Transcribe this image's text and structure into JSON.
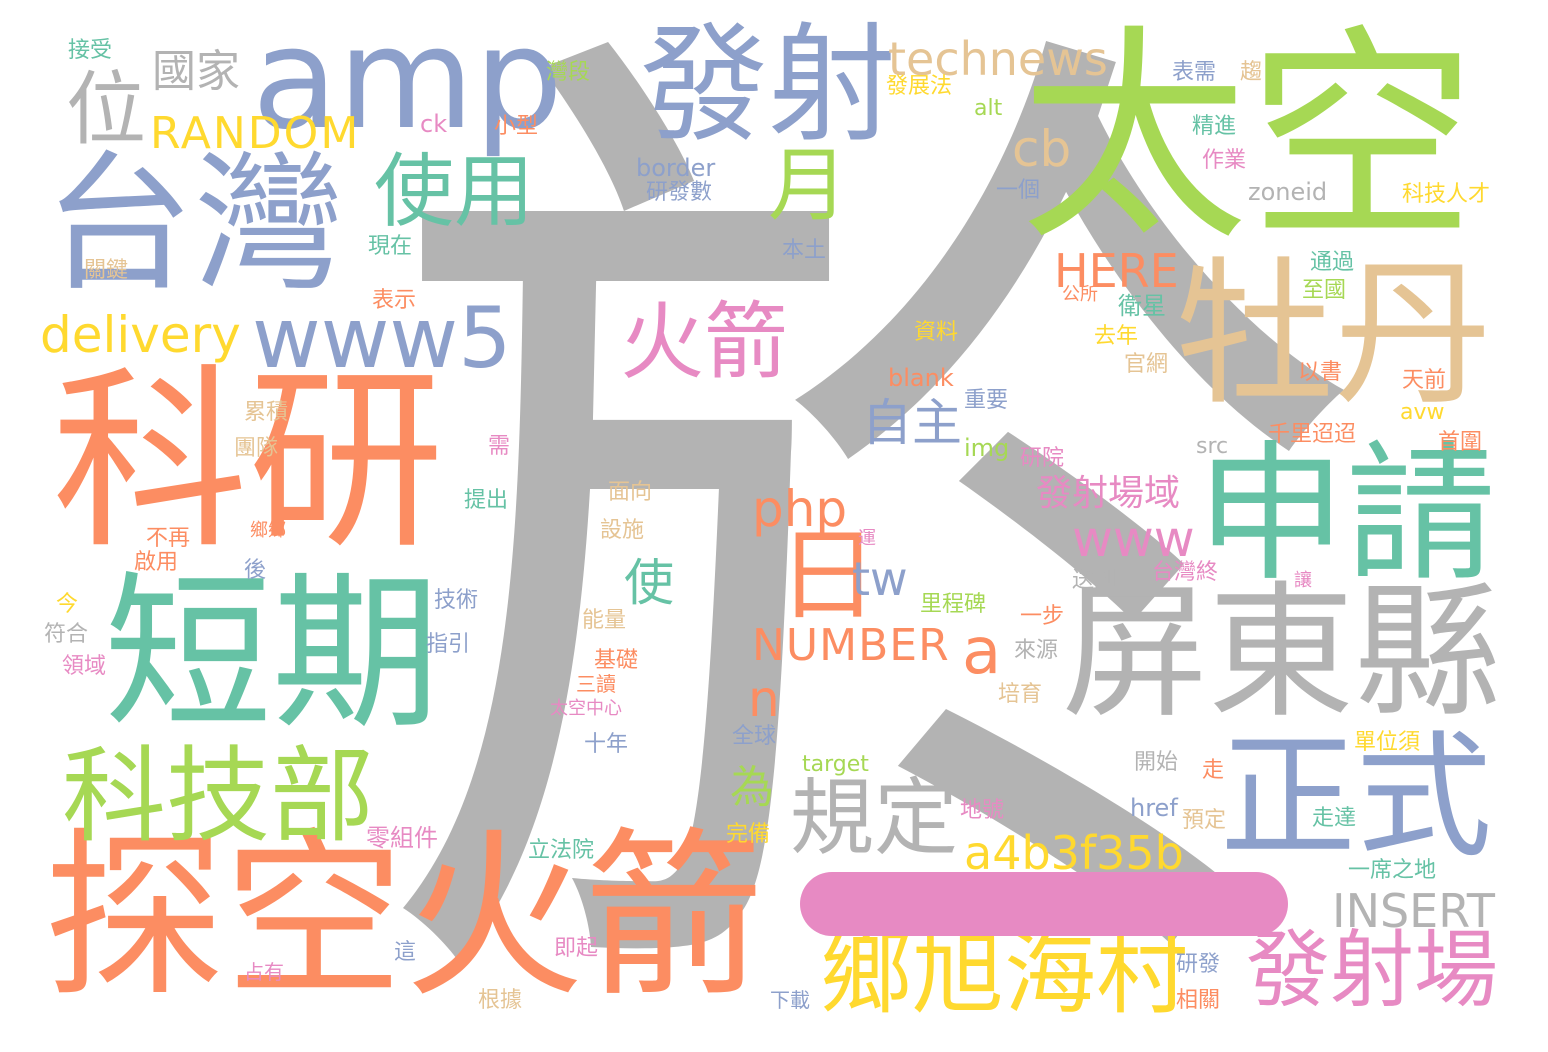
{
  "palette": {
    "gray": "#b3b3b3",
    "green": "#a6d854",
    "orange": "#fc8d62",
    "blue": "#8da0cb",
    "teal": "#66c2a5",
    "pink": "#e78ac3",
    "yellow": "#ffd92f",
    "tan": "#e5c494"
  },
  "words": {
    "yu": "於",
    "taikong": "太空",
    "amp": "amp",
    "fashe": "發射",
    "taiwan": "台灣",
    "keyan": "科研",
    "mudan": "牡丹",
    "shenqing": "申請",
    "duanqi": "短期",
    "pingdong": "屏東縣",
    "tankong": "探空火箭",
    "zhengshi": "正式",
    "kejibu": "科技部",
    "xiangxu": "鄉旭海村",
    "guiding": "規定",
    "fasheChang": "發射場",
    "wei": "位",
    "guojia": "國家",
    "technews": "technews",
    "random": "RANDOM",
    "shiyong": "使用",
    "yue": "月",
    "cb": "cb",
    "www5": "www5",
    "delivery": "delivery",
    "huojian": "火箭",
    "here": "HERE",
    "zizhu": "自主",
    "php": "php",
    "ri": "日",
    "tw": "tw",
    "a": "a",
    "www": "www",
    "shi": "使",
    "number": "NUMBER",
    "n": "n",
    "weiWord": "為",
    "fasheChangYu": "發射場域",
    "a4b": "a4b3f35b",
    "insert": "INSERT",
    "jieshou": "接受",
    "wanduan": "灣段",
    "xiaoxing": "小型",
    "ck": "ck",
    "border": "border",
    "yanfashu": "研發數",
    "xianzai": "現在",
    "guanjian": "關鍵",
    "biaoshi": "表示",
    "fazhanfa": "發展法",
    "alt": "alt",
    "biaoxu": "表需",
    "qu": "趨",
    "jingjin": "精進",
    "zuoye": "作業",
    "yige": "一個",
    "zoneid": "zoneid",
    "kejirencai": "科技人才",
    "bentu": "本土",
    "tongguo": "通過",
    "gongsuo": "公所",
    "zhiguo": "至國",
    "weixing": "衛星",
    "ziliao": "資料",
    "qunian": "去年",
    "guanwang": "官網",
    "yishu": "以書",
    "tianqian": "天前",
    "blank": "blank",
    "zhongyao": "重要",
    "avw": "avw",
    "leiji": "累積",
    "tuandui": "團隊",
    "img": "img",
    "yanyuan": "研院",
    "xu": "需",
    "src": "src",
    "qianli": "千里迢迢",
    "shouquan": "首圍",
    "tichu": "提出",
    "mianxiang": "面向",
    "buzai": "不再",
    "qiyong": "啟用",
    "xiangxiang": "鄉鄉",
    "sheshi": "設施",
    "yun": "運",
    "hou": "後",
    "songdao": "送到",
    "taiwanzhong": "台灣終",
    "rang": "讓",
    "jin": "今",
    "fuhe": "符合",
    "jishu": "技術",
    "zhiyin": "指引",
    "nengliang": "能量",
    "lichengbei": "里程碑",
    "yibu": "一步",
    "laiyuan": "來源",
    "lingyu": "領域",
    "jichu": "基礎",
    "sandu": "三讀",
    "peiyu": "培育",
    "taikongzhongxin": "太空中心",
    "shinian": "十年",
    "quanqiu": "全球",
    "danweixu": "單位須",
    "kaishi": "開始",
    "target": "target",
    "zou": "走",
    "weiwu": "為",
    "wanbei": "完備",
    "dihao": "地號",
    "href": "href",
    "yuding": "預定",
    "zouda": "走達",
    "lingzujian": "零組件",
    "lifayuan": "立法院",
    "yixizhidi": "一席之地",
    "zhe": "這",
    "jiqi": "即起",
    "zhanyou": "占有",
    "yanfa": "研發",
    "genju": "根據",
    "xiazai": "下載",
    "xiangguan": "相關"
  }
}
